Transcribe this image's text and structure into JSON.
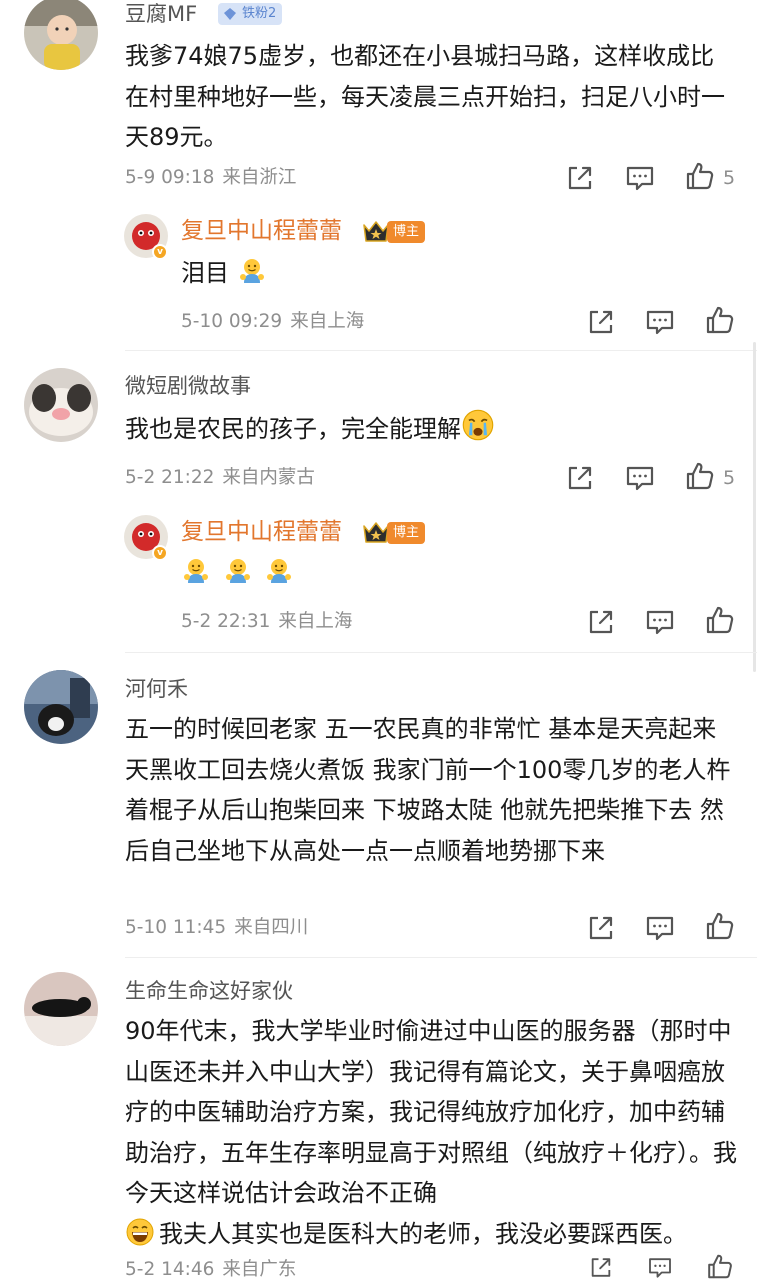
{
  "comments": [
    {
      "user": "豆腐MF",
      "badge": "铁粉2",
      "text": "我爹74娘75虚岁，也都还在小县城扫马路，这样收成比在村里种地好一些，每天凌晨三点开始扫，扫足八小时一天89元。",
      "time": "5-9 09:18",
      "location": "来自浙江",
      "likes": "5",
      "reply": {
        "user": "复旦中山程蕾蕾",
        "role": "博主",
        "text": "泪目",
        "time": "5-10 09:29",
        "location": "来自上海"
      }
    },
    {
      "user": "微短剧微故事",
      "text": "我也是农民的孩子，完全能理解",
      "time": "5-2 21:22",
      "location": "来自内蒙古",
      "likes": "5",
      "reply": {
        "user": "复旦中山程蕾蕾",
        "role": "博主",
        "text": "",
        "time": "5-2 22:31",
        "location": "来自上海"
      }
    },
    {
      "user": "河何禾",
      "text": "五一的时候回老家 五一农民真的非常忙 基本是天亮起来天黑收工回去烧火煮饭 我家门前一个100零几岁的老人杵着棍子从后山抱柴回来 下坡路太陡 他就先把柴推下去 然后自己坐地下从高处一点一点顺着地势挪下来",
      "time": "5-10 11:45",
      "location": "来自四川",
      "likes": ""
    },
    {
      "user": "生命生命这好家伙",
      "text": "90年代末，我大学毕业时偷进过中山医的服务器（那时中山医还未并入中山大学）我记得有篇论文，关于鼻咽癌放疗的中医辅助治疗方案，我记得纯放疗加化疗，加中药辅助治疗，五年生存率明显高于对照组（纯放疗＋化疗）。我今天这样说估计会政治不正确",
      "text2": "我夫人其实也是医科大的老师，我没必要踩西医。",
      "time": "5-2 14:46",
      "location": "来自广东",
      "likes": ""
    }
  ],
  "icons": [
    "share-icon",
    "comment-icon",
    "like-icon",
    "crown-icon",
    "verified-icon"
  ],
  "colors": {
    "reply_name": "#e2762d",
    "blogger_badge": "#f08a2c",
    "fan_badge_bg": "#d7e3f7",
    "meta": "#8e8e8e"
  }
}
